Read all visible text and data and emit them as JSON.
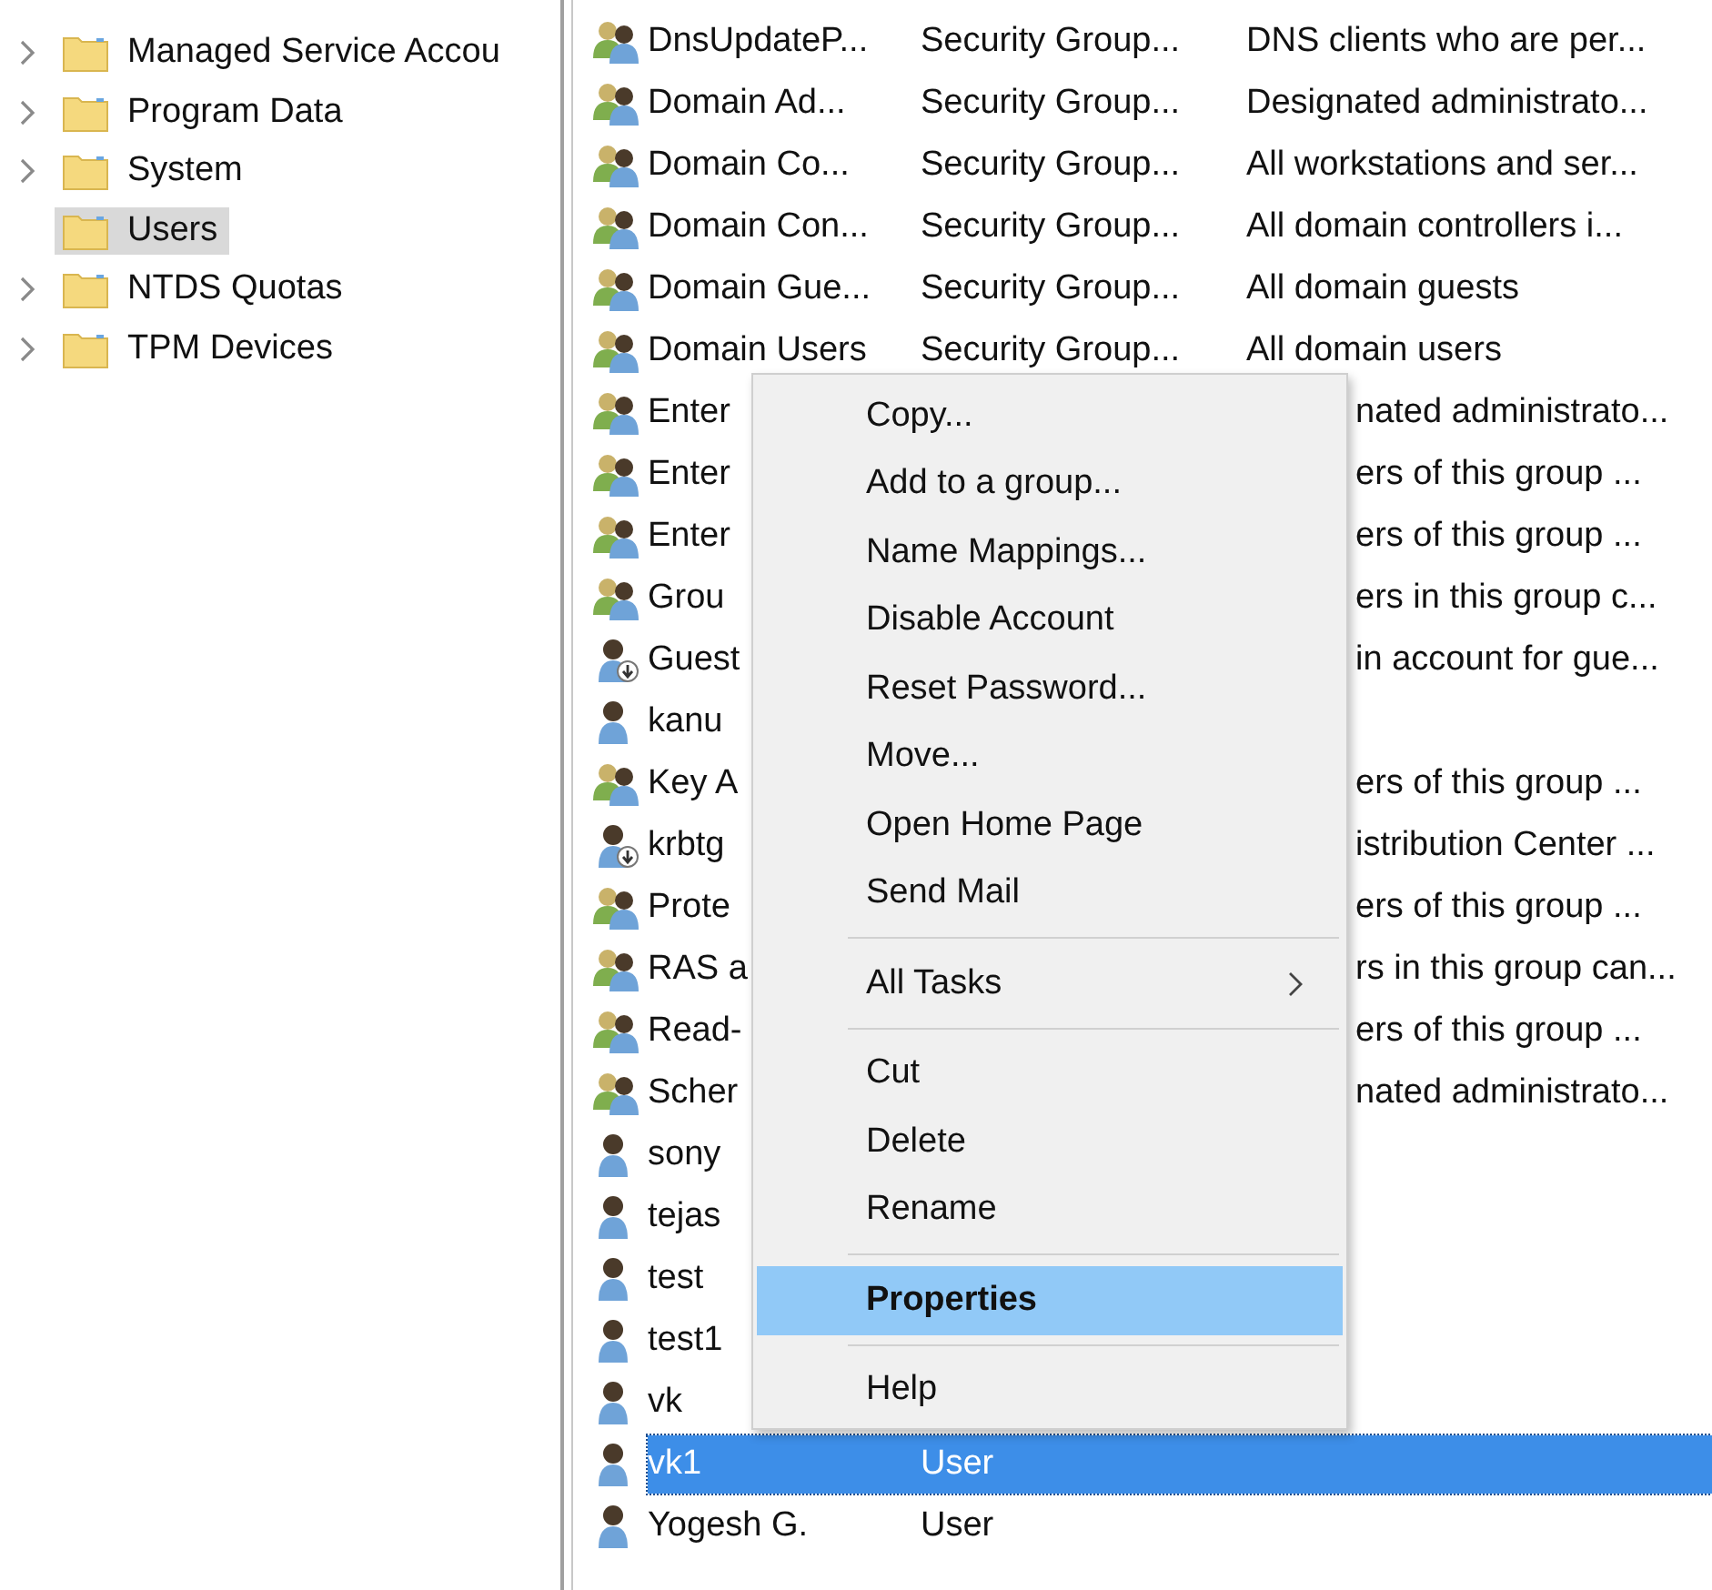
{
  "tree": {
    "items": [
      {
        "label": "Managed Service Accou",
        "expandable": true,
        "selected": false
      },
      {
        "label": "Program Data",
        "expandable": true,
        "selected": false
      },
      {
        "label": "System",
        "expandable": true,
        "selected": false
      },
      {
        "label": "Users",
        "expandable": false,
        "selected": true
      },
      {
        "label": "NTDS Quotas",
        "expandable": true,
        "selected": false
      },
      {
        "label": "TPM Devices",
        "expandable": true,
        "selected": false
      }
    ]
  },
  "list": {
    "rows": [
      {
        "kind": "group",
        "disabled": false,
        "selected": false,
        "name": "DnsUpdateP...",
        "type": "Security Group...",
        "description": "DNS clients who are per..."
      },
      {
        "kind": "group",
        "disabled": false,
        "selected": false,
        "name": "Domain Ad...",
        "type": "Security Group...",
        "description": "Designated administrato..."
      },
      {
        "kind": "group",
        "disabled": false,
        "selected": false,
        "name": "Domain Co...",
        "type": "Security Group...",
        "description": "All workstations and ser..."
      },
      {
        "kind": "group",
        "disabled": false,
        "selected": false,
        "name": "Domain Con...",
        "type": "Security Group...",
        "description": "All domain controllers i..."
      },
      {
        "kind": "group",
        "disabled": false,
        "selected": false,
        "name": "Domain Gue...",
        "type": "Security Group...",
        "description": "All domain guests"
      },
      {
        "kind": "group",
        "disabled": false,
        "selected": false,
        "name": "Domain Users",
        "type": "Security Group...",
        "description": "All domain users"
      },
      {
        "kind": "group",
        "disabled": false,
        "selected": false,
        "name": "Enter",
        "description": "nated administrato..."
      },
      {
        "kind": "group",
        "disabled": false,
        "selected": false,
        "name": "Enter",
        "description": "ers of this group ..."
      },
      {
        "kind": "group",
        "disabled": false,
        "selected": false,
        "name": "Enter",
        "description": "ers of this group ..."
      },
      {
        "kind": "group",
        "disabled": false,
        "selected": false,
        "name": "Grou",
        "description": "ers in this group c..."
      },
      {
        "kind": "user",
        "disabled": true,
        "selected": false,
        "name": "Guest",
        "description": "in account for gue..."
      },
      {
        "kind": "user",
        "disabled": false,
        "selected": false,
        "name": "kanu"
      },
      {
        "kind": "group",
        "disabled": false,
        "selected": false,
        "name": "Key A",
        "description": "ers of this group ..."
      },
      {
        "kind": "user",
        "disabled": true,
        "selected": false,
        "name": "krbtg",
        "description": "istribution Center ..."
      },
      {
        "kind": "group",
        "disabled": false,
        "selected": false,
        "name": "Prote",
        "description": "ers of this group ..."
      },
      {
        "kind": "group",
        "disabled": false,
        "selected": false,
        "name": "RAS a",
        "description": "rs in this group can..."
      },
      {
        "kind": "group",
        "disabled": false,
        "selected": false,
        "name": "Read-",
        "description": "ers of this group ..."
      },
      {
        "kind": "group",
        "disabled": false,
        "selected": false,
        "name": "Scher",
        "description": "nated administrato..."
      },
      {
        "kind": "user",
        "disabled": false,
        "selected": false,
        "name": "sony"
      },
      {
        "kind": "user",
        "disabled": false,
        "selected": false,
        "name": "tejas"
      },
      {
        "kind": "user",
        "disabled": false,
        "selected": false,
        "name": "test"
      },
      {
        "kind": "user",
        "disabled": false,
        "selected": false,
        "name": "test1"
      },
      {
        "kind": "user",
        "disabled": false,
        "selected": false,
        "name": "vk"
      },
      {
        "kind": "user",
        "disabled": false,
        "selected": true,
        "name": "vk1",
        "type": "User"
      },
      {
        "kind": "user",
        "disabled": false,
        "selected": false,
        "name": "Yogesh G.",
        "type": "User"
      }
    ]
  },
  "context_menu": {
    "sections": [
      [
        {
          "label": "Copy...",
          "selected": false,
          "default": false,
          "submenu": false
        },
        {
          "label": "Add to a group...",
          "selected": false,
          "default": false,
          "submenu": false
        },
        {
          "label": "Name Mappings...",
          "selected": false,
          "default": false,
          "submenu": false
        },
        {
          "label": "Disable Account",
          "selected": false,
          "default": false,
          "submenu": false
        },
        {
          "label": "Reset Password...",
          "selected": false,
          "default": false,
          "submenu": false
        },
        {
          "label": "Move...",
          "selected": false,
          "default": false,
          "submenu": false
        },
        {
          "label": "Open Home Page",
          "selected": false,
          "default": false,
          "submenu": false
        },
        {
          "label": "Send Mail",
          "selected": false,
          "default": false,
          "submenu": false
        }
      ],
      [
        {
          "label": "All Tasks",
          "selected": false,
          "default": false,
          "submenu": true
        }
      ],
      [
        {
          "label": "Cut",
          "selected": false,
          "default": false,
          "submenu": false
        },
        {
          "label": "Delete",
          "selected": false,
          "default": false,
          "submenu": false
        },
        {
          "label": "Rename",
          "selected": false,
          "default": false,
          "submenu": false
        }
      ],
      [
        {
          "label": "Properties",
          "selected": true,
          "default": true,
          "submenu": false
        }
      ],
      [
        {
          "label": "Help",
          "selected": false,
          "default": false,
          "submenu": false
        }
      ]
    ]
  }
}
